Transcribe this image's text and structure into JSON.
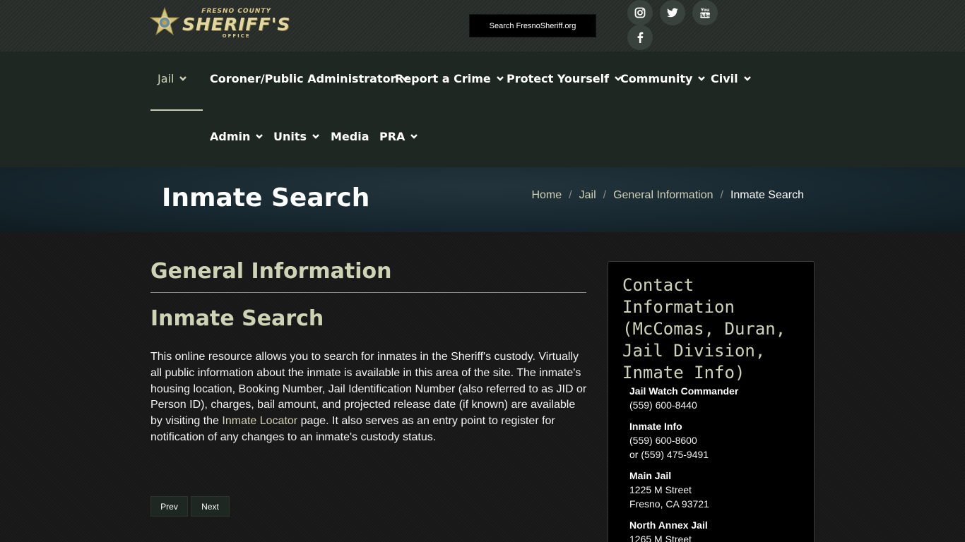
{
  "header": {
    "logo": {
      "line1": "FRESNO COUNTY",
      "line2": "SHERIFF'S",
      "line3": "OFFICE"
    },
    "search_label": "Search FresnoSheriff.org",
    "social": [
      {
        "name": "instagram-icon"
      },
      {
        "name": "twitter-icon"
      },
      {
        "name": "youtube-icon"
      },
      {
        "name": "facebook-icon"
      }
    ]
  },
  "nav": {
    "row1": [
      "Jail",
      "Coroner/Public Administrator",
      "Report a Crime",
      "Protect Yourself",
      "Community",
      "Civil"
    ],
    "row2": [
      "Admin",
      "Units",
      "Media",
      "PRA"
    ]
  },
  "banner": {
    "title": "Inmate Search",
    "breadcrumb": [
      "Home",
      "Jail",
      "General Information",
      "Inmate Search"
    ],
    "separator": "/"
  },
  "main": {
    "section_heading": "General Information",
    "page_heading": "Inmate Search",
    "paragraph_before": "This online resource allows you to search for inmates in the Sheriff's custody. Virtually all public information about the inmate is available in this area of the site. The inmate's housing location, Booking Number, Jail Identification Number (also referred to as JID or Person ID), charges, bail amount, and projected release date (if known) are available by visiting the ",
    "link_text": "Inmate Locator",
    "paragraph_after": " page. It also serves as an entry point to register for notification of any changes to an inmate's custody status.",
    "prev_label": "Prev",
    "next_label": "Next"
  },
  "sidebar": {
    "title": "Contact Information (McComas, Duran, Jail Division, Inmate Info)",
    "contacts": [
      {
        "label": "Jail Watch Commander",
        "line1": "(559) 600-8440",
        "line2": ""
      },
      {
        "label": "Inmate Info",
        "line1": "(559) 600-8600",
        "line2": "or (559) 475-9491"
      },
      {
        "label": "Main Jail",
        "line1": "1225 M Street",
        "line2": "Fresno, CA  93721"
      },
      {
        "label": "North Annex Jail",
        "line1": "1265 M Street",
        "line2": ""
      }
    ]
  },
  "colors": {
    "accent_text": "#cfd3b6",
    "nav_bg": "#1f2722",
    "sidebar_bg": "#000000"
  }
}
